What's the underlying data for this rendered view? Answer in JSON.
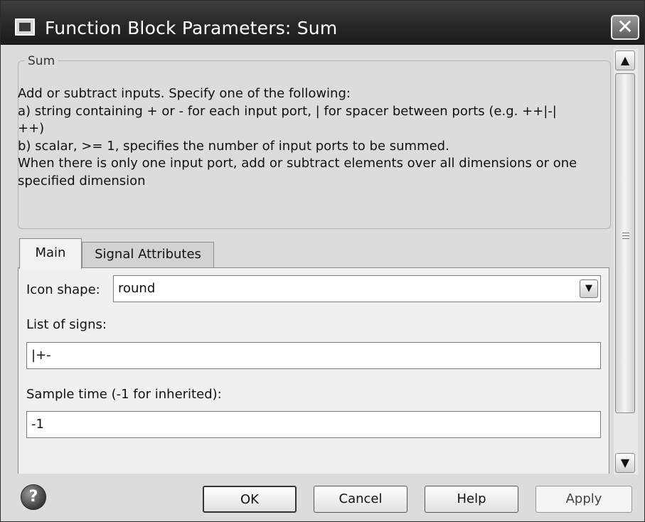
{
  "window": {
    "title": "Function Block Parameters: Sum",
    "close_glyph": "✕"
  },
  "description": {
    "group_label": "Sum",
    "lines": [
      "Add or subtract inputs.  Specify one of the following:",
      "a) string containing + or - for each input port, | for spacer between ports (e.g. ++|-|",
      "++)",
      "b) scalar, >= 1, specifies the number of input ports to be summed.",
      "When there is only one input port, add or subtract elements over all dimensions or one",
      "specified dimension"
    ]
  },
  "tabs": [
    {
      "label": "Main",
      "active": true
    },
    {
      "label": "Signal Attributes",
      "active": false
    }
  ],
  "main": {
    "icon_shape_label": "Icon shape:",
    "icon_shape_value": "round",
    "list_of_signs_label": "List of signs:",
    "list_of_signs_value": "|+-",
    "sample_time_label": "Sample time (-1 for inherited):",
    "sample_time_value": "-1"
  },
  "scrollbar": {
    "up_glyph": "▲",
    "down_glyph": "▼"
  },
  "buttons": {
    "help_icon_glyph": "?",
    "ok": "OK",
    "cancel": "Cancel",
    "help": "Help",
    "apply": "Apply"
  }
}
